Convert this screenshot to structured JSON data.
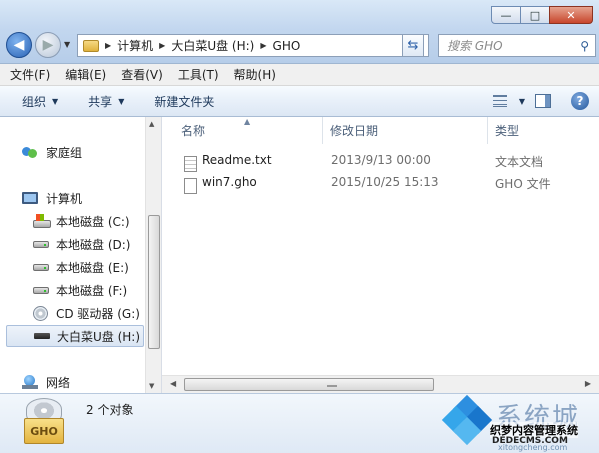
{
  "window": {
    "minimize_glyph": "—",
    "maximize_glyph": "□",
    "close_glyph": "✕"
  },
  "address": {
    "crumbs": [
      "计算机",
      "大白菜U盘 (H:)",
      "GHO"
    ]
  },
  "search": {
    "placeholder": "搜索 GHO"
  },
  "menu": [
    "文件(F)",
    "编辑(E)",
    "查看(V)",
    "工具(T)",
    "帮助(H)"
  ],
  "toolbar": {
    "organize": "组织",
    "share": "共享",
    "new_folder": "新建文件夹"
  },
  "navpane": {
    "homegroup": "家庭组",
    "computer": "计算机",
    "drives": [
      {
        "label": "本地磁盘 (C:)",
        "icon": "system-drive-icon"
      },
      {
        "label": "本地磁盘 (D:)",
        "icon": "drive-icon"
      },
      {
        "label": "本地磁盘 (E:)",
        "icon": "drive-icon"
      },
      {
        "label": "本地磁盘 (F:)",
        "icon": "drive-icon"
      },
      {
        "label": "CD 驱动器 (G:)",
        "icon": "cd-drive-icon"
      },
      {
        "label": "大白菜U盘 (H:)",
        "icon": "usb-drive-icon",
        "selected": true
      }
    ],
    "network": "网络"
  },
  "columns": {
    "name": "名称",
    "date": "修改日期",
    "type": "类型"
  },
  "files": [
    {
      "name": "Readme.txt",
      "date": "2013/9/13 00:00",
      "type": "文本文档",
      "icon": "text-file-icon"
    },
    {
      "name": "win7.gho",
      "date": "2015/10/25 15:13",
      "type": "GHO 文件",
      "icon": "file-icon"
    }
  ],
  "details": {
    "count": "2 个对象",
    "icon_label": "GHO"
  },
  "watermark": {
    "big": "系统城",
    "small": "织梦内容管理系统",
    "domain": "DEDECMS.COM",
    "sub": "xitongcheng.com"
  },
  "colors": {
    "selection_bg": "#dae5f3",
    "toolbar_text": "#1e395b",
    "header_text": "#4c607a"
  }
}
